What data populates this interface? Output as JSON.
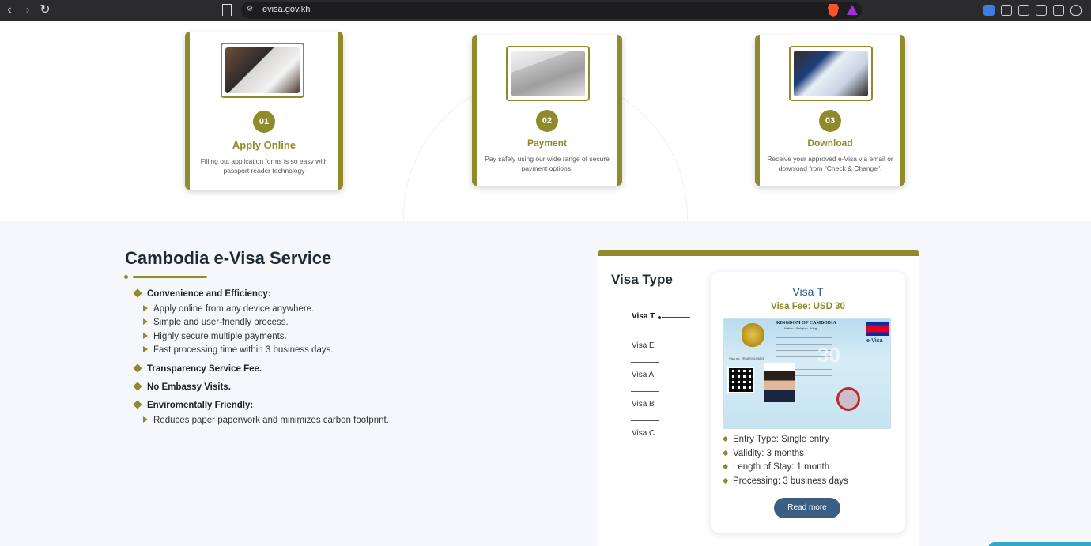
{
  "browser": {
    "url": "evisa.gov.kh",
    "back_icon": "chevron-left-icon",
    "forward_icon": "chevron-right-icon",
    "reload_icon": "reload-icon"
  },
  "steps": [
    {
      "number": "01",
      "title": "Apply Online",
      "description": "Filling out application forms is so easy with passport reader technology",
      "image": "tablet-photo"
    },
    {
      "number": "02",
      "title": "Payment",
      "description": "Pay safely using our wide range of secure payment options.",
      "image": "credit-cards-photo"
    },
    {
      "number": "03",
      "title": "Download",
      "description": "Receive your approved e-Visa via email or download from \"Check & Change\".",
      "image": "tablet-document-photo"
    }
  ],
  "service": {
    "title": "Cambodia e-Visa Service",
    "features": [
      {
        "label": "Convenience and Efficiency:",
        "items": [
          "Apply online from any device anywhere.",
          "Simple and user-friendly process.",
          "Highly secure multiple payments.",
          "Fast processing time within 3 business days."
        ]
      },
      {
        "label": "Transparency Service Fee.",
        "items": []
      },
      {
        "label": "No Embassy Visits.",
        "items": []
      },
      {
        "label": "Enviromentally Friendly:",
        "items": [
          "Reduces paper paperwork and minimizes carbon footprint."
        ]
      }
    ]
  },
  "visa_panel": {
    "title": "Visa Type",
    "tabs": [
      "Visa T",
      "Visa E",
      "Visa A",
      "Visa B",
      "Visa C"
    ],
    "active_tab": "Visa T",
    "card": {
      "name": "Visa T",
      "fee": "Visa Fee: USD 30",
      "image_texts": {
        "kingdom": "KINGDOM OF CAMBODIA",
        "motto": "Nation - Religion - King",
        "logo": "e-Visa",
        "amount": "30",
        "visa_no": "Visa no: 2R58705159828"
      },
      "details": [
        "Entry Type: Single entry",
        "Validity: 3 months",
        "Length of Stay: 1 month",
        "Processing: 3 business days"
      ],
      "button": "Read more"
    }
  },
  "colors": {
    "accent": "#8f8a2a",
    "button": "#3a5f82",
    "visa_name": "#2f5a86"
  }
}
